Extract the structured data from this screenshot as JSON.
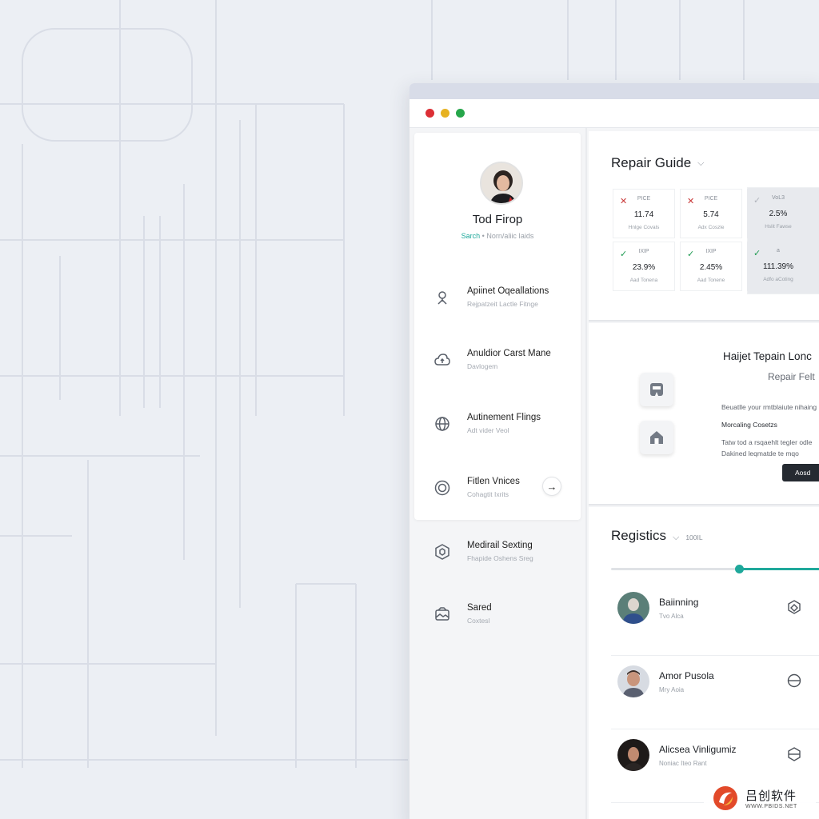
{
  "window": {
    "controls": [
      "close",
      "minimize",
      "maximize"
    ],
    "colors": {
      "close": "#dc2f35",
      "minimize": "#e7b221",
      "maximize": "#26a64a",
      "accent": "#1fa89b"
    }
  },
  "profile": {
    "name": "Tod Firop",
    "sub_accent": "Sarch",
    "sub_separator": "•",
    "sub_text": "Norn/aliic Iaids"
  },
  "sidebar": {
    "items": [
      {
        "title": "Apiinet Oqeallations",
        "desc": "Rejpatzeit Lactle Fitnge",
        "icon": "location-pin-icon"
      },
      {
        "title": "Anuldior Carst Mane",
        "desc": "Davlogem",
        "icon": "cloud-upload-icon"
      },
      {
        "title": "Autinement Flings",
        "desc": "Adt vider Veol",
        "icon": "globe-icon"
      },
      {
        "title": "Fitlen Vnices",
        "desc": "Cohagtit Ixrits",
        "icon": "target-icon"
      },
      {
        "title": "Medirail Sexting",
        "desc": "Fhapide Oshens Sreg",
        "icon": "hexagon-icon"
      },
      {
        "title": "Sared",
        "desc": "Coxtesl",
        "icon": "image-box-icon"
      }
    ],
    "arrow": "→"
  },
  "repair_guide": {
    "title": "Repair Guide",
    "chevron": "⌵",
    "stats": [
      {
        "mark": "✕",
        "mark_type": "x",
        "label": "PICE",
        "value": "11.74",
        "desc": "Hnlge Covals"
      },
      {
        "mark": "✕",
        "mark_type": "x",
        "label": "PICE",
        "value": "5.74",
        "desc": "Adx Coszle"
      },
      {
        "mark": "✓",
        "mark_type": "muted",
        "label": "VoL3",
        "value": "2.5%",
        "desc": "Hslit Fawse"
      },
      {
        "mark": "✓",
        "mark_type": "check",
        "label": "IXIP",
        "value": "23.9%",
        "desc": "Aad Tonena"
      },
      {
        "mark": "✓",
        "mark_type": "check",
        "label": "IXIP",
        "value": "2.45%",
        "desc": "Aad Tonene"
      },
      {
        "mark": "✓",
        "mark_type": "check",
        "label": "a",
        "value": "111.39%",
        "desc": "Adfo aCoting"
      }
    ]
  },
  "feature": {
    "title": "Haijet Tepain Lonc",
    "subtitle": "Repair Felt",
    "line1": "Beuatlle your rmtblaiute nihaing",
    "line2": "Morcaling Cosetzs",
    "line3": "Tatw tod a rsqaehlt tegler odle",
    "line4": "Dakined leqmatde te mqo",
    "action": "Aosd",
    "icons": [
      "store-icon",
      "house-icon"
    ]
  },
  "registics": {
    "title": "Registics",
    "chevron": "⌵",
    "count": "100IL",
    "progress": 0.59,
    "rows": [
      {
        "name": "Baiinning",
        "role": "Tvo Alca"
      },
      {
        "name": "Amor Pusola",
        "role": "Mry Aoia"
      },
      {
        "name": "Alicsea Vinligumiz",
        "role": "Noniac Iteo Rant"
      }
    ]
  },
  "watermark": {
    "cn": "吕创软件",
    "url": "WWW.PBIDS.NET"
  }
}
